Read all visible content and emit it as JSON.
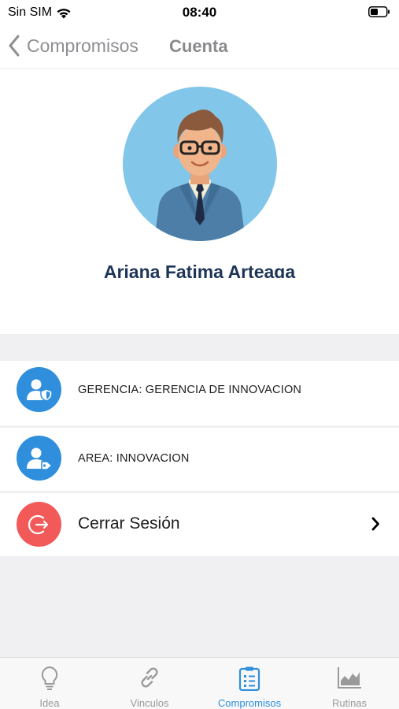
{
  "status_bar": {
    "carrier": "Sin SIM",
    "time": "08:40"
  },
  "nav": {
    "back_label": "Compromisos",
    "title": "Cuenta"
  },
  "profile": {
    "name": "Ariana Fatima Arteaga"
  },
  "list": [
    {
      "label": "GERENCIA: GERENCIA DE INNOVACION",
      "icon": "user-shield-icon"
    },
    {
      "label": "AREA: INNOVACION",
      "icon": "user-tag-icon"
    },
    {
      "label": "Cerrar Sesión",
      "icon": "logout-icon"
    }
  ],
  "tabs": [
    {
      "label": "Idea",
      "icon": "lightbulb-icon"
    },
    {
      "label": "Vinculos",
      "icon": "link-icon"
    },
    {
      "label": "Compromisos",
      "icon": "clipboard-list-icon",
      "active": true
    },
    {
      "label": "Rutinas",
      "icon": "area-chart-icon"
    }
  ],
  "colors": {
    "accent": "#2f8fdc",
    "logout": "#f25a5a",
    "name": "#1d3557"
  }
}
